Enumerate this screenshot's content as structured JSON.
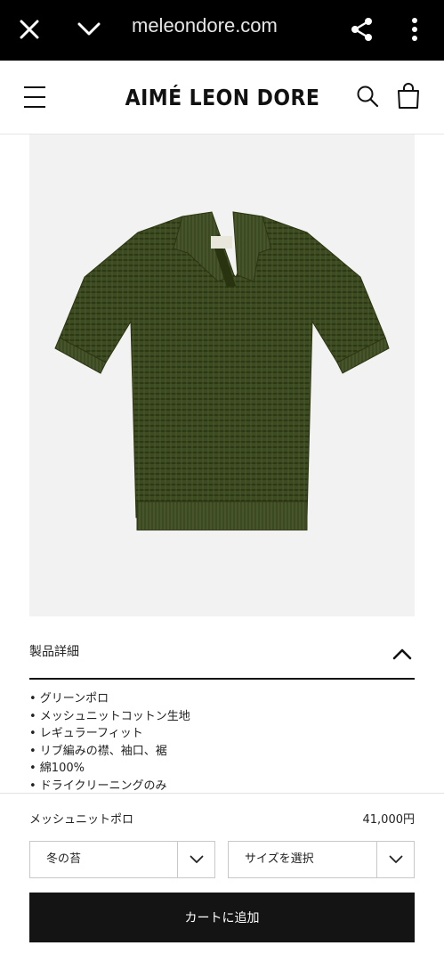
{
  "browser": {
    "url": "meleondore.com",
    "icons": [
      "close-icon",
      "chevron-down-icon",
      "share-icon",
      "more-vertical-icon"
    ]
  },
  "header": {
    "brand": "AIMÉ LEON DORE",
    "icons": [
      "hamburger-menu-icon",
      "search-icon",
      "shopping-bag-icon"
    ]
  },
  "product_image": {
    "alt": "green mesh knit polo shirt",
    "background": "#f2f2f2",
    "garment_color": "#3b4a20"
  },
  "details": {
    "title": "製品詳細",
    "expanded": true,
    "items": [
      "• グリーンポロ",
      "• メッシュニットコットン生地",
      "• レギュラーフィット",
      "• リブ編みの襟、袖口、裾",
      "• 綿100%",
      "• ドライクリーニングのみ"
    ]
  },
  "purchase": {
    "product_name": "メッシュニットポロ",
    "price": "41,000円",
    "color_select": "冬の苔",
    "size_select": "サイズを選択",
    "add_to_cart": "カートに追加",
    "button_color": "#141414"
  }
}
